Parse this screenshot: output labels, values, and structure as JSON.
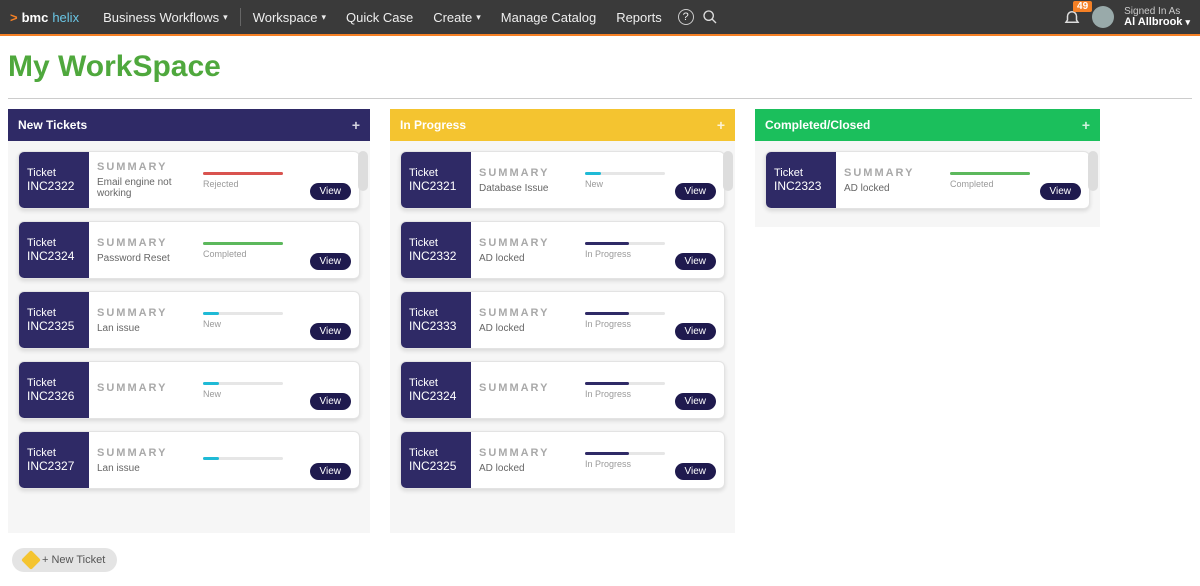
{
  "nav": {
    "brand_prefix": ">",
    "brand_main": "bmc",
    "brand_sub": "helix",
    "items": [
      {
        "label": "Business Workflows",
        "caret": true
      },
      {
        "label": "Workspace",
        "caret": true
      },
      {
        "label": "Quick Case",
        "caret": false
      },
      {
        "label": "Create",
        "caret": true
      },
      {
        "label": "Manage Catalog",
        "caret": false
      },
      {
        "label": "Reports",
        "caret": false
      }
    ],
    "help_icon": "?",
    "search_icon": "search",
    "notification_count": "49",
    "signed_in_label": "Signed In As",
    "user_name": "Al Allbrook"
  },
  "page": {
    "title": "My WorkSpace"
  },
  "lanes": {
    "new": {
      "title": "New Tickets",
      "cards": [
        {
          "id": "INC2322",
          "ticket_label": "Ticket",
          "summary_label": "SUMMARY",
          "summary": "Email engine not working",
          "status": "Rejected",
          "bar_class": "bar-red",
          "bar_w": "100%",
          "view": "View"
        },
        {
          "id": "INC2324",
          "ticket_label": "Ticket",
          "summary_label": "SUMMARY",
          "summary": "Password Reset",
          "status": "Completed",
          "bar_class": "bar-green",
          "bar_w": "100%",
          "view": "View"
        },
        {
          "id": "INC2325",
          "ticket_label": "Ticket",
          "summary_label": "SUMMARY",
          "summary": "Lan issue",
          "status": "New",
          "bar_class": "bar-teal",
          "bar_w": "20%",
          "view": "View"
        },
        {
          "id": "INC2326",
          "ticket_label": "Ticket",
          "summary_label": "SUMMARY",
          "summary": "",
          "status": "New",
          "bar_class": "bar-teal",
          "bar_w": "20%",
          "view": "View"
        },
        {
          "id": "INC2327",
          "ticket_label": "Ticket",
          "summary_label": "SUMMARY",
          "summary": "Lan issue",
          "status": "",
          "bar_class": "bar-teal",
          "bar_w": "20%",
          "view": "View"
        }
      ]
    },
    "prog": {
      "title": "In Progress",
      "cards": [
        {
          "id": "INC2321",
          "ticket_label": "Ticket",
          "summary_label": "SUMMARY",
          "summary": "Database Issue",
          "status": "New",
          "bar_class": "bar-teal",
          "bar_w": "20%",
          "view": "View"
        },
        {
          "id": "INC2332",
          "ticket_label": "Ticket",
          "summary_label": "SUMMARY",
          "summary": "AD locked",
          "status": "In Progress",
          "bar_class": "bar-navy",
          "bar_w": "55%",
          "view": "View"
        },
        {
          "id": "INC2333",
          "ticket_label": "Ticket",
          "summary_label": "SUMMARY",
          "summary": "AD locked",
          "status": "In Progress",
          "bar_class": "bar-navy",
          "bar_w": "55%",
          "view": "View"
        },
        {
          "id": "INC2324",
          "ticket_label": "Ticket",
          "summary_label": "SUMMARY",
          "summary": "",
          "status": "In Progress",
          "bar_class": "bar-navy",
          "bar_w": "55%",
          "view": "View"
        },
        {
          "id": "INC2325",
          "ticket_label": "Ticket",
          "summary_label": "SUMMARY",
          "summary": "AD locked",
          "status": "In Progress",
          "bar_class": "bar-navy",
          "bar_w": "55%",
          "view": "View"
        }
      ]
    },
    "done": {
      "title": "Completed/Closed",
      "cards": [
        {
          "id": "INC2323",
          "ticket_label": "Ticket",
          "summary_label": "SUMMARY",
          "summary": "AD locked",
          "status": "Completed",
          "bar_class": "bar-green",
          "bar_w": "100%",
          "view": "View"
        }
      ]
    }
  },
  "bottom": {
    "new_ticket": "+ New Ticket"
  }
}
